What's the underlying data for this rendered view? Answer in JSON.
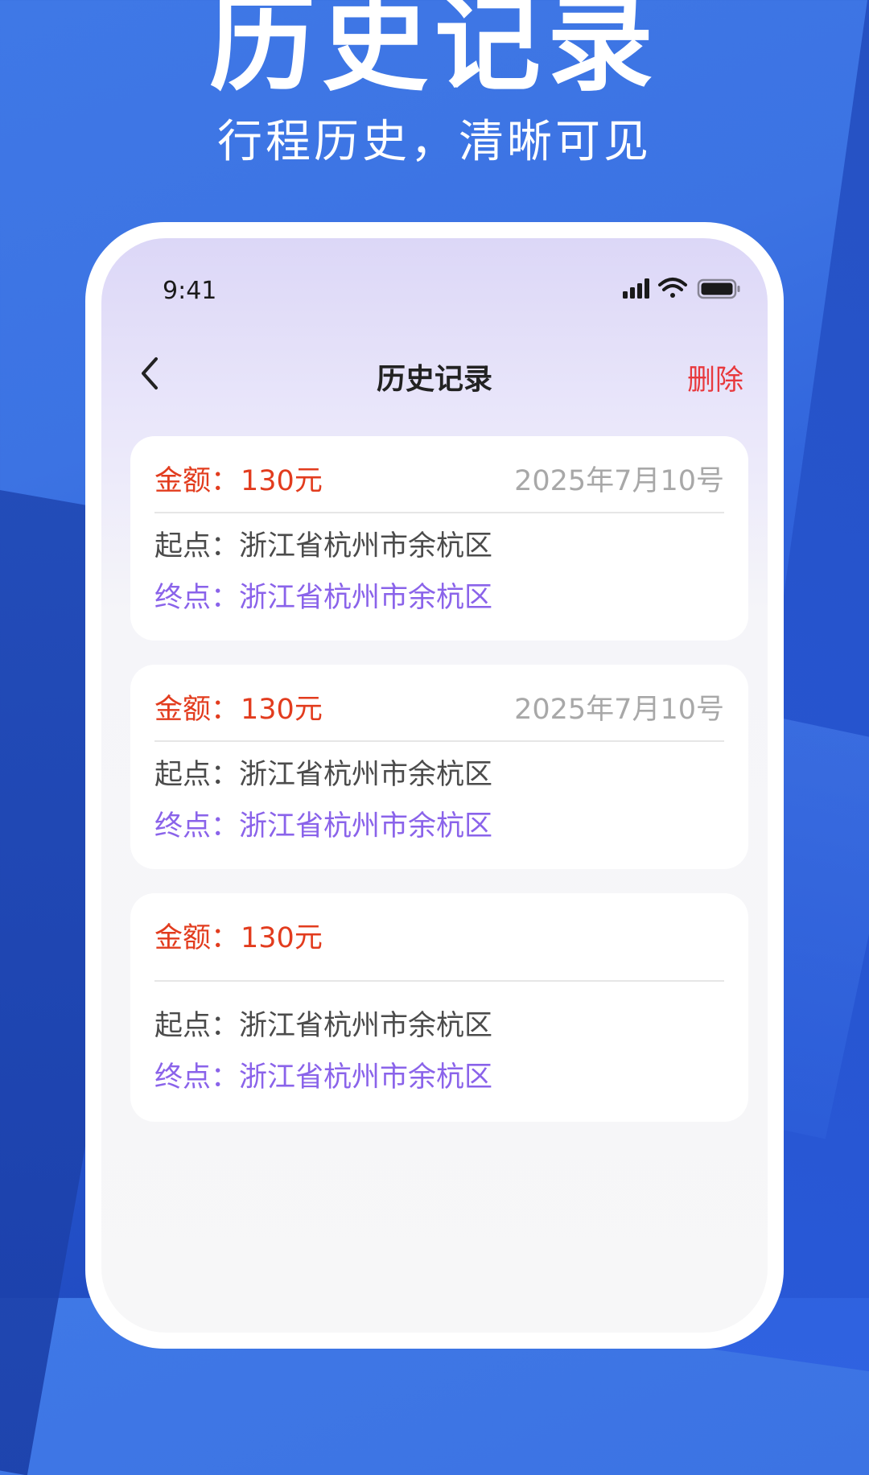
{
  "hero": {
    "title": "历史记录",
    "subtitle": "行程历史，清晰可见"
  },
  "status_bar": {
    "time": "9:41",
    "icons": [
      "signal-icon",
      "wifi-icon",
      "battery-icon"
    ]
  },
  "nav": {
    "back_icon": "chevron-left-icon",
    "title": "历史记录",
    "delete_label": "删除"
  },
  "colors": {
    "amount": "#e23c1e",
    "destination": "#8a63ea",
    "delete": "#e8383d",
    "date": "#a8a8a8"
  },
  "records": [
    {
      "amount_label": "金额：",
      "amount_value": "130元",
      "date": "2025年7月10号",
      "start_label": "起点：",
      "start_value": "浙江省杭州市余杭区",
      "end_label": "终点：",
      "end_value": "浙江省杭州市余杭区"
    },
    {
      "amount_label": "金额：",
      "amount_value": "130元",
      "date": "2025年7月10号",
      "start_label": "起点：",
      "start_value": "浙江省杭州市余杭区",
      "end_label": "终点：",
      "end_value": "浙江省杭州市余杭区"
    },
    {
      "amount_label": "金额：",
      "amount_value": "130元",
      "date": "",
      "start_label": "起点：",
      "start_value": "浙江省杭州市余杭区",
      "end_label": "终点：",
      "end_value": "浙江省杭州市余杭区"
    }
  ]
}
